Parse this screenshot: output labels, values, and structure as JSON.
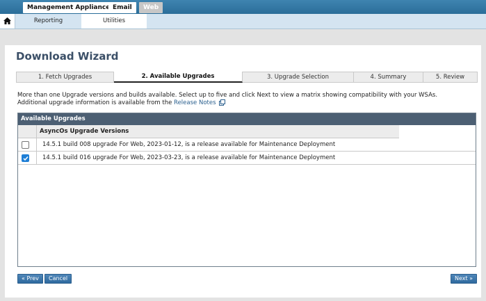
{
  "top_tabs": [
    "Management Appliance",
    "Email",
    "Web"
  ],
  "nav": {
    "items": [
      "Reporting",
      "Utilities"
    ]
  },
  "wizard": {
    "title": "Download Wizard",
    "steps": [
      "1. Fetch Upgrades",
      "2. Available Upgrades",
      "3. Upgrade Selection",
      "4. Summary",
      "5. Review"
    ],
    "active_step": 1,
    "description_line1": "More than one Upgrade versions and builds available. Select up to five and click Next to view a matrix showing compatibility with your WSAs.",
    "description_line2": "Additional upgrade information is available from the",
    "release_notes_link": "Release Notes"
  },
  "table": {
    "title": "Available Upgrades",
    "column_header": "AsyncOs Upgrade Versions",
    "rows": [
      {
        "text": "14.5.1 build 008 upgrade For Web, 2023-01-12, is a release available for Maintenance Deployment",
        "checked": false
      },
      {
        "text": "14.5.1 build 016 upgrade For Web, 2023-03-23, is a release available for Maintenance Deployment",
        "checked": true
      }
    ]
  },
  "buttons": {
    "prev": "« Prev",
    "cancel": "Cancel",
    "next": "Next »"
  },
  "colors": {
    "accent": "#2f6a9f",
    "table_header": "#4c5f73",
    "title": "#3b4f67"
  },
  "icons": {
    "home": "home-icon",
    "external": "external-link-icon",
    "check": "checkmark-icon"
  }
}
